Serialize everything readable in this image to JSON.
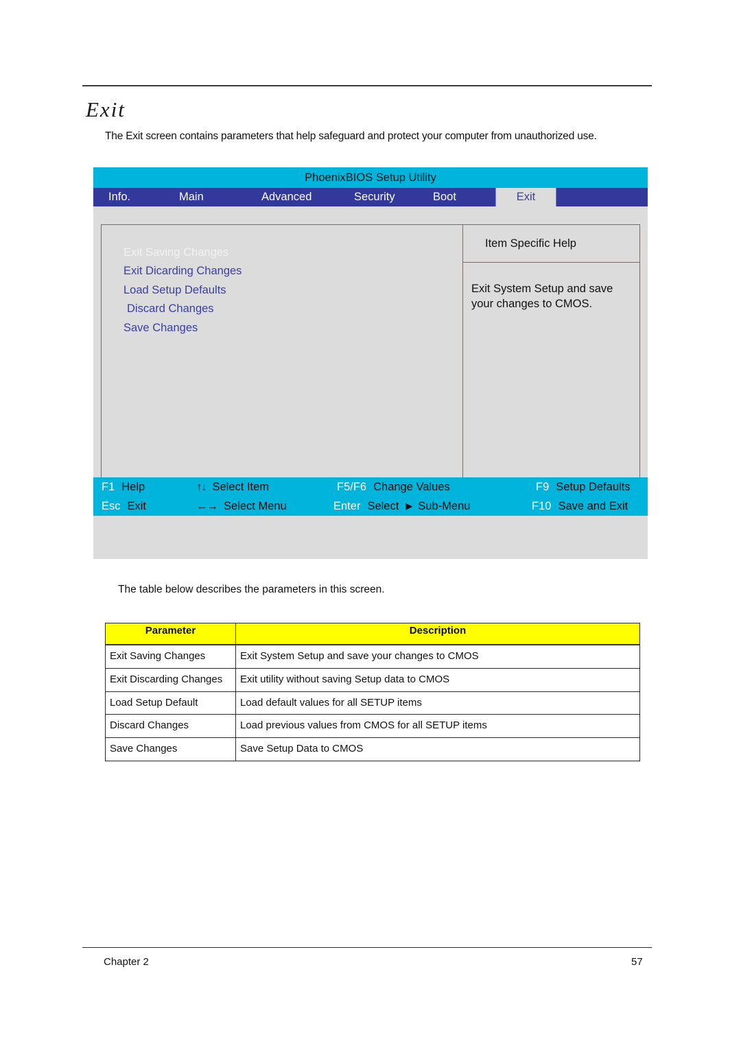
{
  "page": {
    "heading": "Exit",
    "intro": "The Exit screen contains parameters that help safeguard and protect your computer from unauthorized use.",
    "table_intro": "The table below describes the parameters in this screen.",
    "footer_left": "Chapter 2",
    "footer_right": "57"
  },
  "bios": {
    "title": "PhoenixBIOS Setup Utility",
    "tabs": [
      {
        "label": "Info.",
        "selected": false
      },
      {
        "label": "Main",
        "selected": false
      },
      {
        "label": "Advanced",
        "selected": false
      },
      {
        "label": "Security",
        "selected": false
      },
      {
        "label": "Boot",
        "selected": false
      },
      {
        "label": "Exit",
        "selected": true
      }
    ],
    "menu_items": [
      {
        "label": "Exit Saving Changes",
        "selected": true,
        "indent": false
      },
      {
        "label": "Exit Dicarding Changes",
        "selected": false,
        "indent": false
      },
      {
        "label": "Load Setup Defaults",
        "selected": false,
        "indent": false
      },
      {
        "label": "Discard Changes",
        "selected": false,
        "indent": true
      },
      {
        "label": "Save Changes",
        "selected": false,
        "indent": false
      }
    ],
    "help": {
      "header": "Item Specific Help",
      "body": "Exit System Setup and save your changes to CMOS."
    },
    "keybar": {
      "row1": [
        {
          "key": "F1",
          "action": "Help"
        },
        {
          "key": "↑↓",
          "action": "Select Item"
        },
        {
          "key": "F5/F6",
          "action": "Change Values"
        },
        {
          "key": "F9",
          "action": "Setup Defaults"
        }
      ],
      "row2": [
        {
          "key": "Esc",
          "action": "Exit"
        },
        {
          "key": "←→",
          "action": "Select Menu"
        },
        {
          "key": "Enter",
          "action": "Select"
        },
        {
          "key": "F10",
          "action": "Save and Exit"
        }
      ],
      "submenu_label": "Sub-Menu",
      "submenu_glyph": "▶"
    },
    "colors": {
      "title_bar": "#00b4dc",
      "tab_bar": "#33399b",
      "panel_bg": "#dcdcdc",
      "menu_text": "#3b3fa0",
      "selected_tab_bg": "#dcdcdc"
    }
  },
  "table": {
    "headers": [
      "Parameter",
      "Description"
    ],
    "rows": [
      {
        "parameter": "Exit Saving Changes",
        "description": "Exit System Setup and save your changes to CMOS"
      },
      {
        "parameter": "Exit Discarding Changes",
        "description": "Exit utility without saving Setup data to CMOS"
      },
      {
        "parameter": "Load Setup Default",
        "description": "Load default values for all SETUP items"
      },
      {
        "parameter": "Discard Changes",
        "description": "Load previous values from CMOS for all SETUP items"
      },
      {
        "parameter": "Save Changes",
        "description": "Save Setup Data to CMOS"
      }
    ],
    "header_bg": "#ffff00",
    "header_color": "#0b0b33"
  }
}
